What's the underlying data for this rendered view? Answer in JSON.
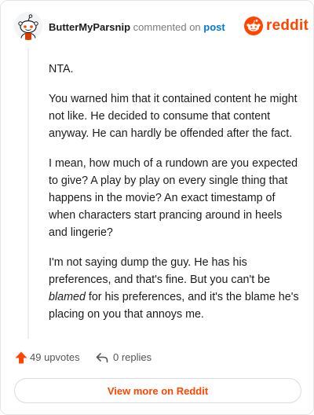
{
  "header": {
    "username": "ButterMyParsnip",
    "action_text": "commented on",
    "post_link": "post",
    "brand": "reddit"
  },
  "comment": {
    "paragraphs": [
      {
        "text": "NTA."
      },
      {
        "text": "You warned him that it contained content he might not like. He decided to consume that content anyway. He can hardly be offended after the fact."
      },
      {
        "text": "I mean, how much of a rundown are you expected to give? A play by play on every single thing that happens in the movie? An exact timestamp of when characters start prancing around in heels and lingerie?"
      },
      {
        "before": "I'm not saying dump the guy. He has his preferences, and that's fine. But you can't be ",
        "emphasis": "blamed",
        "after": " for his preferences, and it's the blame he's placing on you that annoys me."
      }
    ]
  },
  "stats": {
    "upvotes": "49 upvotes",
    "replies": "0 replies"
  },
  "footer": {
    "button_label": "View more on Reddit"
  },
  "colors": {
    "brand_orange": "#ff4500",
    "link_blue": "#0079d3"
  },
  "icons": [
    "snoo-avatar-icon",
    "reddit-logo-icon",
    "upvote-arrow-icon",
    "reply-arrow-icon"
  ]
}
